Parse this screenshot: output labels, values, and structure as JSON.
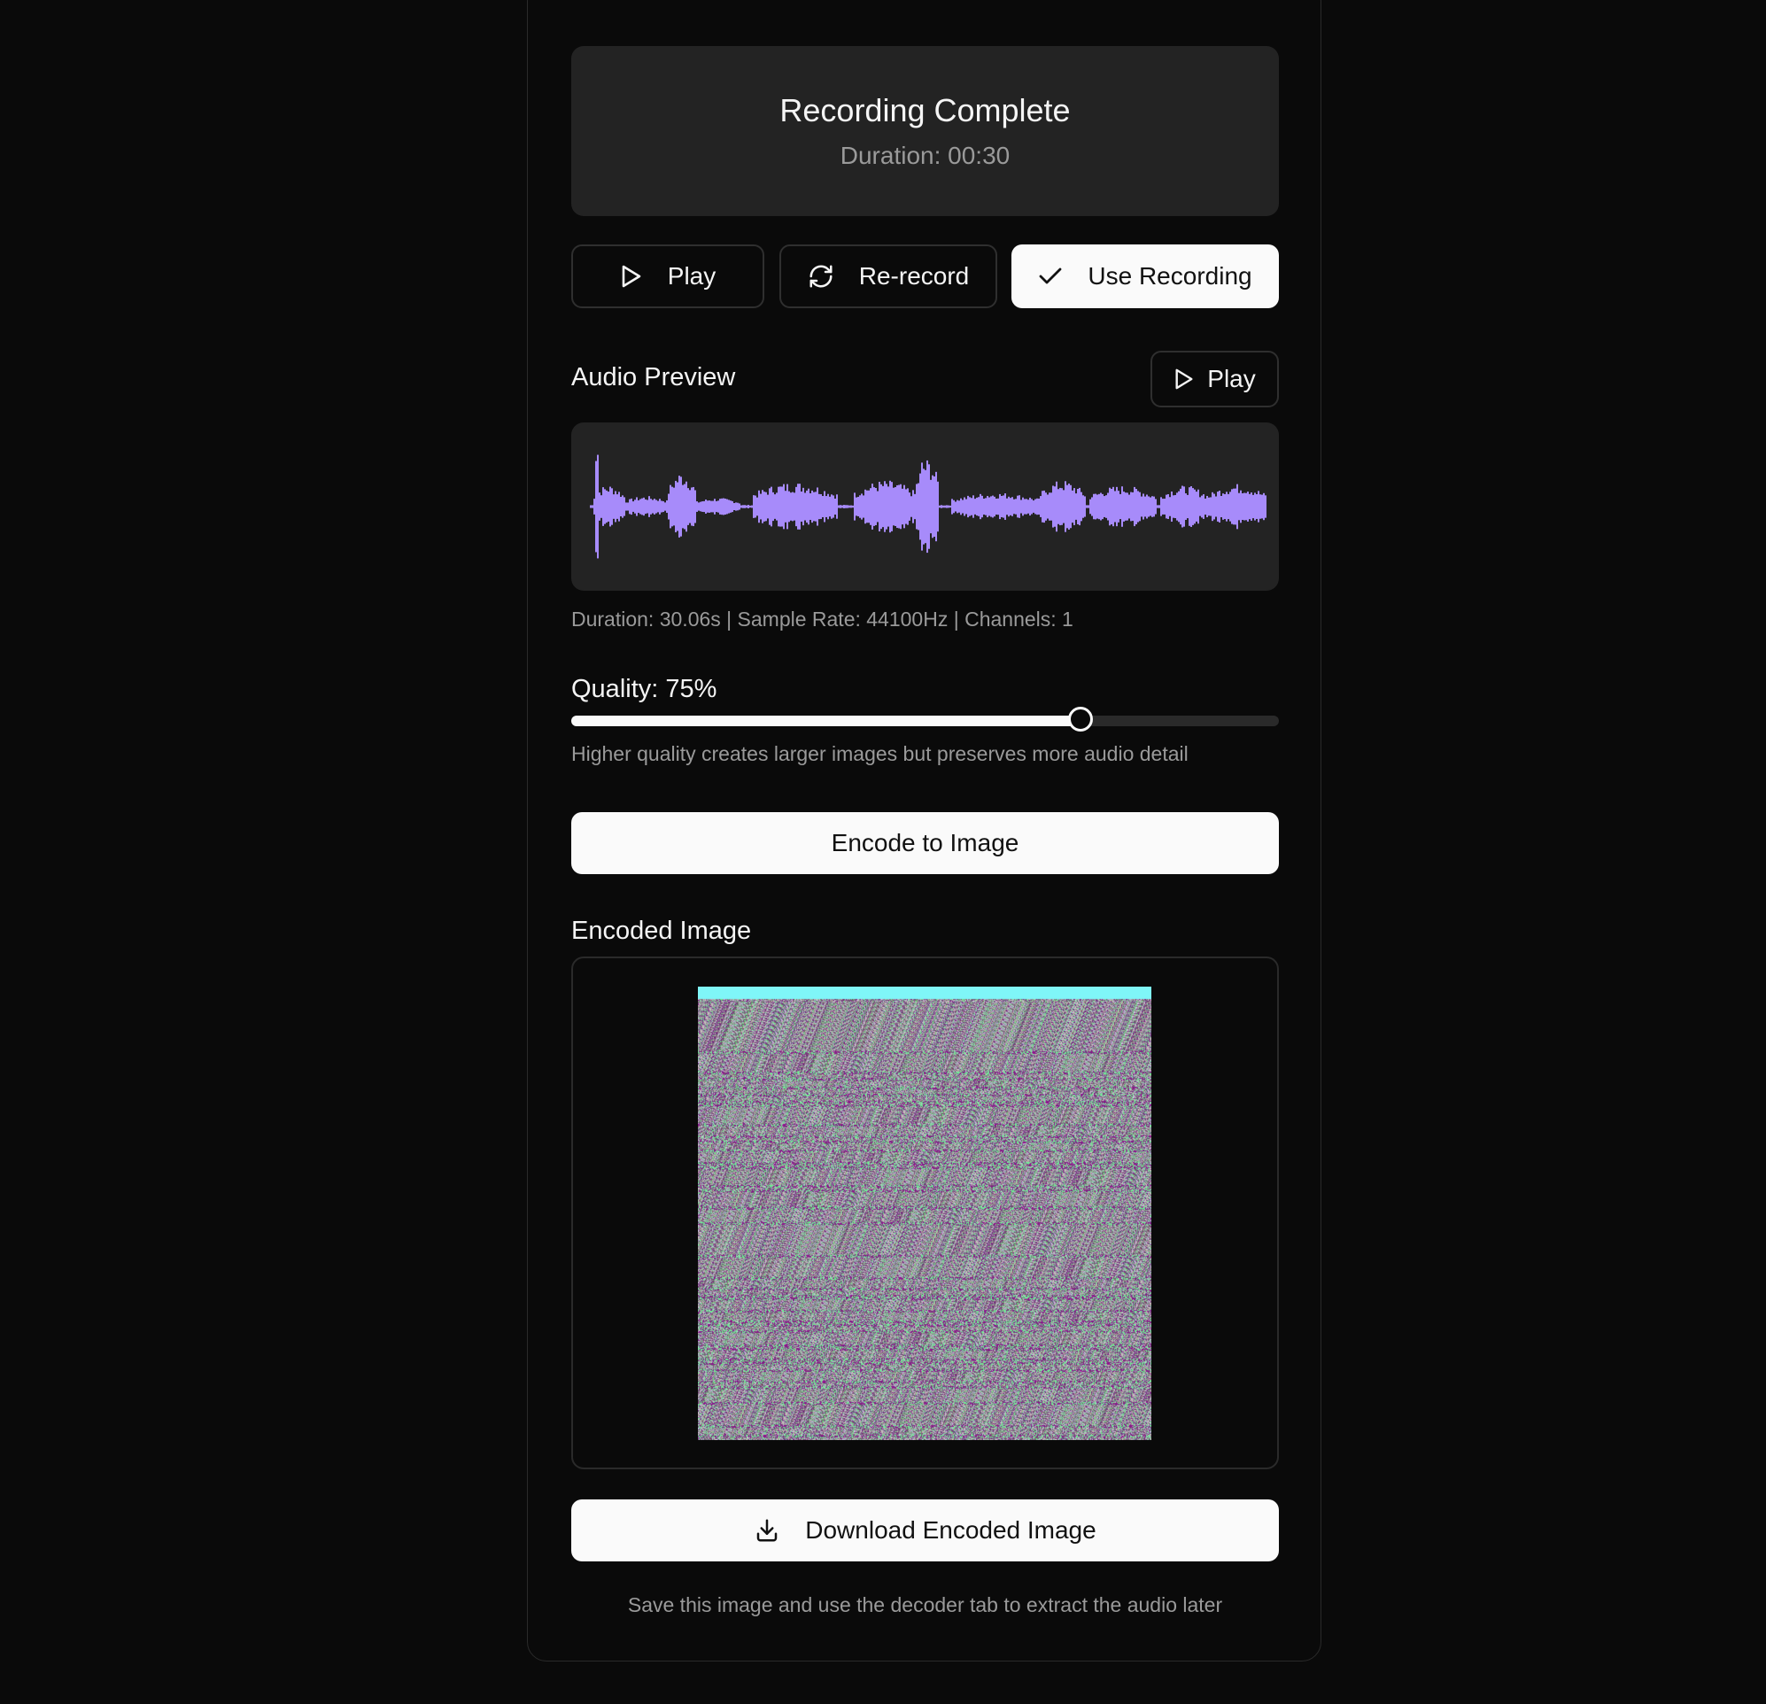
{
  "status": {
    "title": "Recording Complete",
    "duration": "Duration: 00:30"
  },
  "actions": {
    "play_label": "Play",
    "rerecord_label": "Re-record",
    "use_label": "Use Recording"
  },
  "preview": {
    "title": "Audio Preview",
    "play_label": "Play",
    "meta": "Duration: 30.06s | Sample Rate: 44100Hz | Channels: 1",
    "waveform_color": "#a78bfa"
  },
  "quality": {
    "label": "Quality: 75%",
    "value": 75,
    "min": 0,
    "max": 100,
    "hint": "Higher quality creates larger images but preserves more audio detail"
  },
  "encode": {
    "button_label": "Encode to Image"
  },
  "encoded": {
    "title": "Encoded Image",
    "header_color": "#7ff6f8",
    "download_label": "Download Encoded Image",
    "note": "Save this image and use the decoder tab to extract the audio later"
  },
  "icons": {
    "play": "play-icon",
    "rerecord": "refresh-icon",
    "use": "check-icon",
    "download": "download-icon"
  }
}
